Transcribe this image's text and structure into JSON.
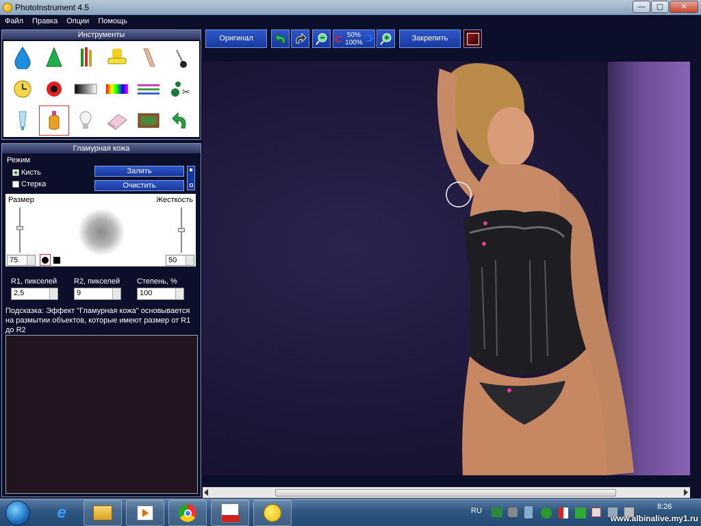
{
  "window": {
    "title": "PhotoInstrument 4.5"
  },
  "menu": [
    "Файл",
    "Правка",
    "Опции",
    "Помощь"
  ],
  "tools_panel": {
    "title": "Инструменты"
  },
  "glamour_panel": {
    "title": "Гламурная кожа",
    "mode_label": "Режим",
    "brush_label": "Кисть",
    "eraser_label": "Стерка",
    "fill_button": "Залить",
    "clear_button": "Очистить",
    "size_label": "Размер",
    "hardness_label": "Жесткость",
    "size_value": "75",
    "hardness_value": "50",
    "r1_label": "R1, пикселей",
    "r2_label": "R2, пикселей",
    "strength_label": "Степень, %",
    "r1_value": "2,5",
    "r2_value": "9",
    "strength_value": "100",
    "hint": "Подсказка: Эффект \"Гламурная кожа\" основывается на размытии объектов, которые имеют размер от R1 до R2"
  },
  "toolbar": {
    "original_button": "Оригинал",
    "pin_button": "Закрепить",
    "zoom_top": "50%",
    "zoom_bottom": "100%"
  },
  "tray": {
    "language": "RU",
    "time": "8:26",
    "watermark": "www.albinalive.my1.ru"
  },
  "colors": {
    "accent": "#1f46b8",
    "panel_bg": "#0b0f2a"
  }
}
